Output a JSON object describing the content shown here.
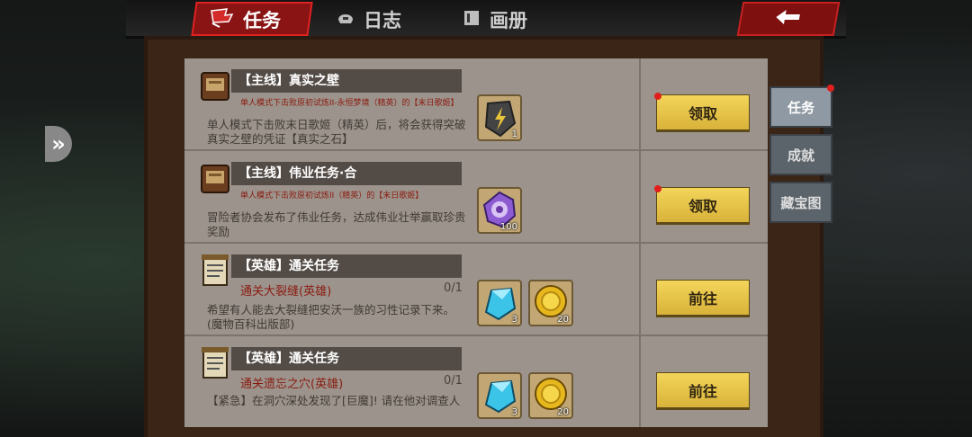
{
  "top_tabs": [
    {
      "label": "任务",
      "icon": "flag-icon",
      "active": true
    },
    {
      "label": "日志",
      "icon": "helmet-icon",
      "active": false
    },
    {
      "label": "画册",
      "icon": "book-icon",
      "active": false
    }
  ],
  "side_tabs": [
    {
      "label": "任务",
      "active": true,
      "has_dot": true
    },
    {
      "label": "成就",
      "active": false,
      "has_dot": false
    },
    {
      "label": "藏宝图",
      "active": false,
      "has_dot": false
    }
  ],
  "quests": [
    {
      "icon": "book-icon",
      "title": "【主线】真实之壁",
      "objective": "单人模式下击败原初试炼II-永恒梦境（精英）的【末日歌姬】",
      "progress": "",
      "description": "单人模式下击败末日歌姬（精英）后，将会获得突破真实之壁的凭证【真实之石】",
      "rewards": [
        {
          "icon": "rune-stone-icon",
          "count": "1"
        }
      ],
      "button": "领取",
      "button_dot": true
    },
    {
      "icon": "book-icon",
      "title": "【主线】伟业任务·合",
      "objective": "单人模式下击败原初试炼II（精英）的【末日歌姬】",
      "progress": "",
      "description": "冒险者协会发布了伟业任务，达成伟业壮举赢取珍贵奖励",
      "rewards": [
        {
          "icon": "purple-coin-icon",
          "count": "100"
        }
      ],
      "button": "领取",
      "button_dot": true
    },
    {
      "icon": "scroll-icon",
      "title": "【英雄】通关任务",
      "objective": "通关大裂缝(英雄)",
      "progress": "0/1",
      "description": "希望有人能去大裂缝把安沃一族的习性记录下来。(魔物百科出版部)",
      "rewards": [
        {
          "icon": "blue-crystal-icon",
          "count": "3"
        },
        {
          "icon": "gold-coin-icon",
          "count": "20"
        }
      ],
      "button": "前往",
      "button_dot": false
    },
    {
      "icon": "scroll-icon",
      "title": "【英雄】通关任务",
      "objective": "通关遗忘之穴(英雄)",
      "progress": "0/1",
      "description": "【紧急】在洞穴深处发现了[巨魔]! 请在他对调查人",
      "rewards": [
        {
          "icon": "blue-crystal-icon",
          "count": "3"
        },
        {
          "icon": "gold-coin-icon",
          "count": "20"
        }
      ],
      "button": "前往",
      "button_dot": false
    }
  ]
}
